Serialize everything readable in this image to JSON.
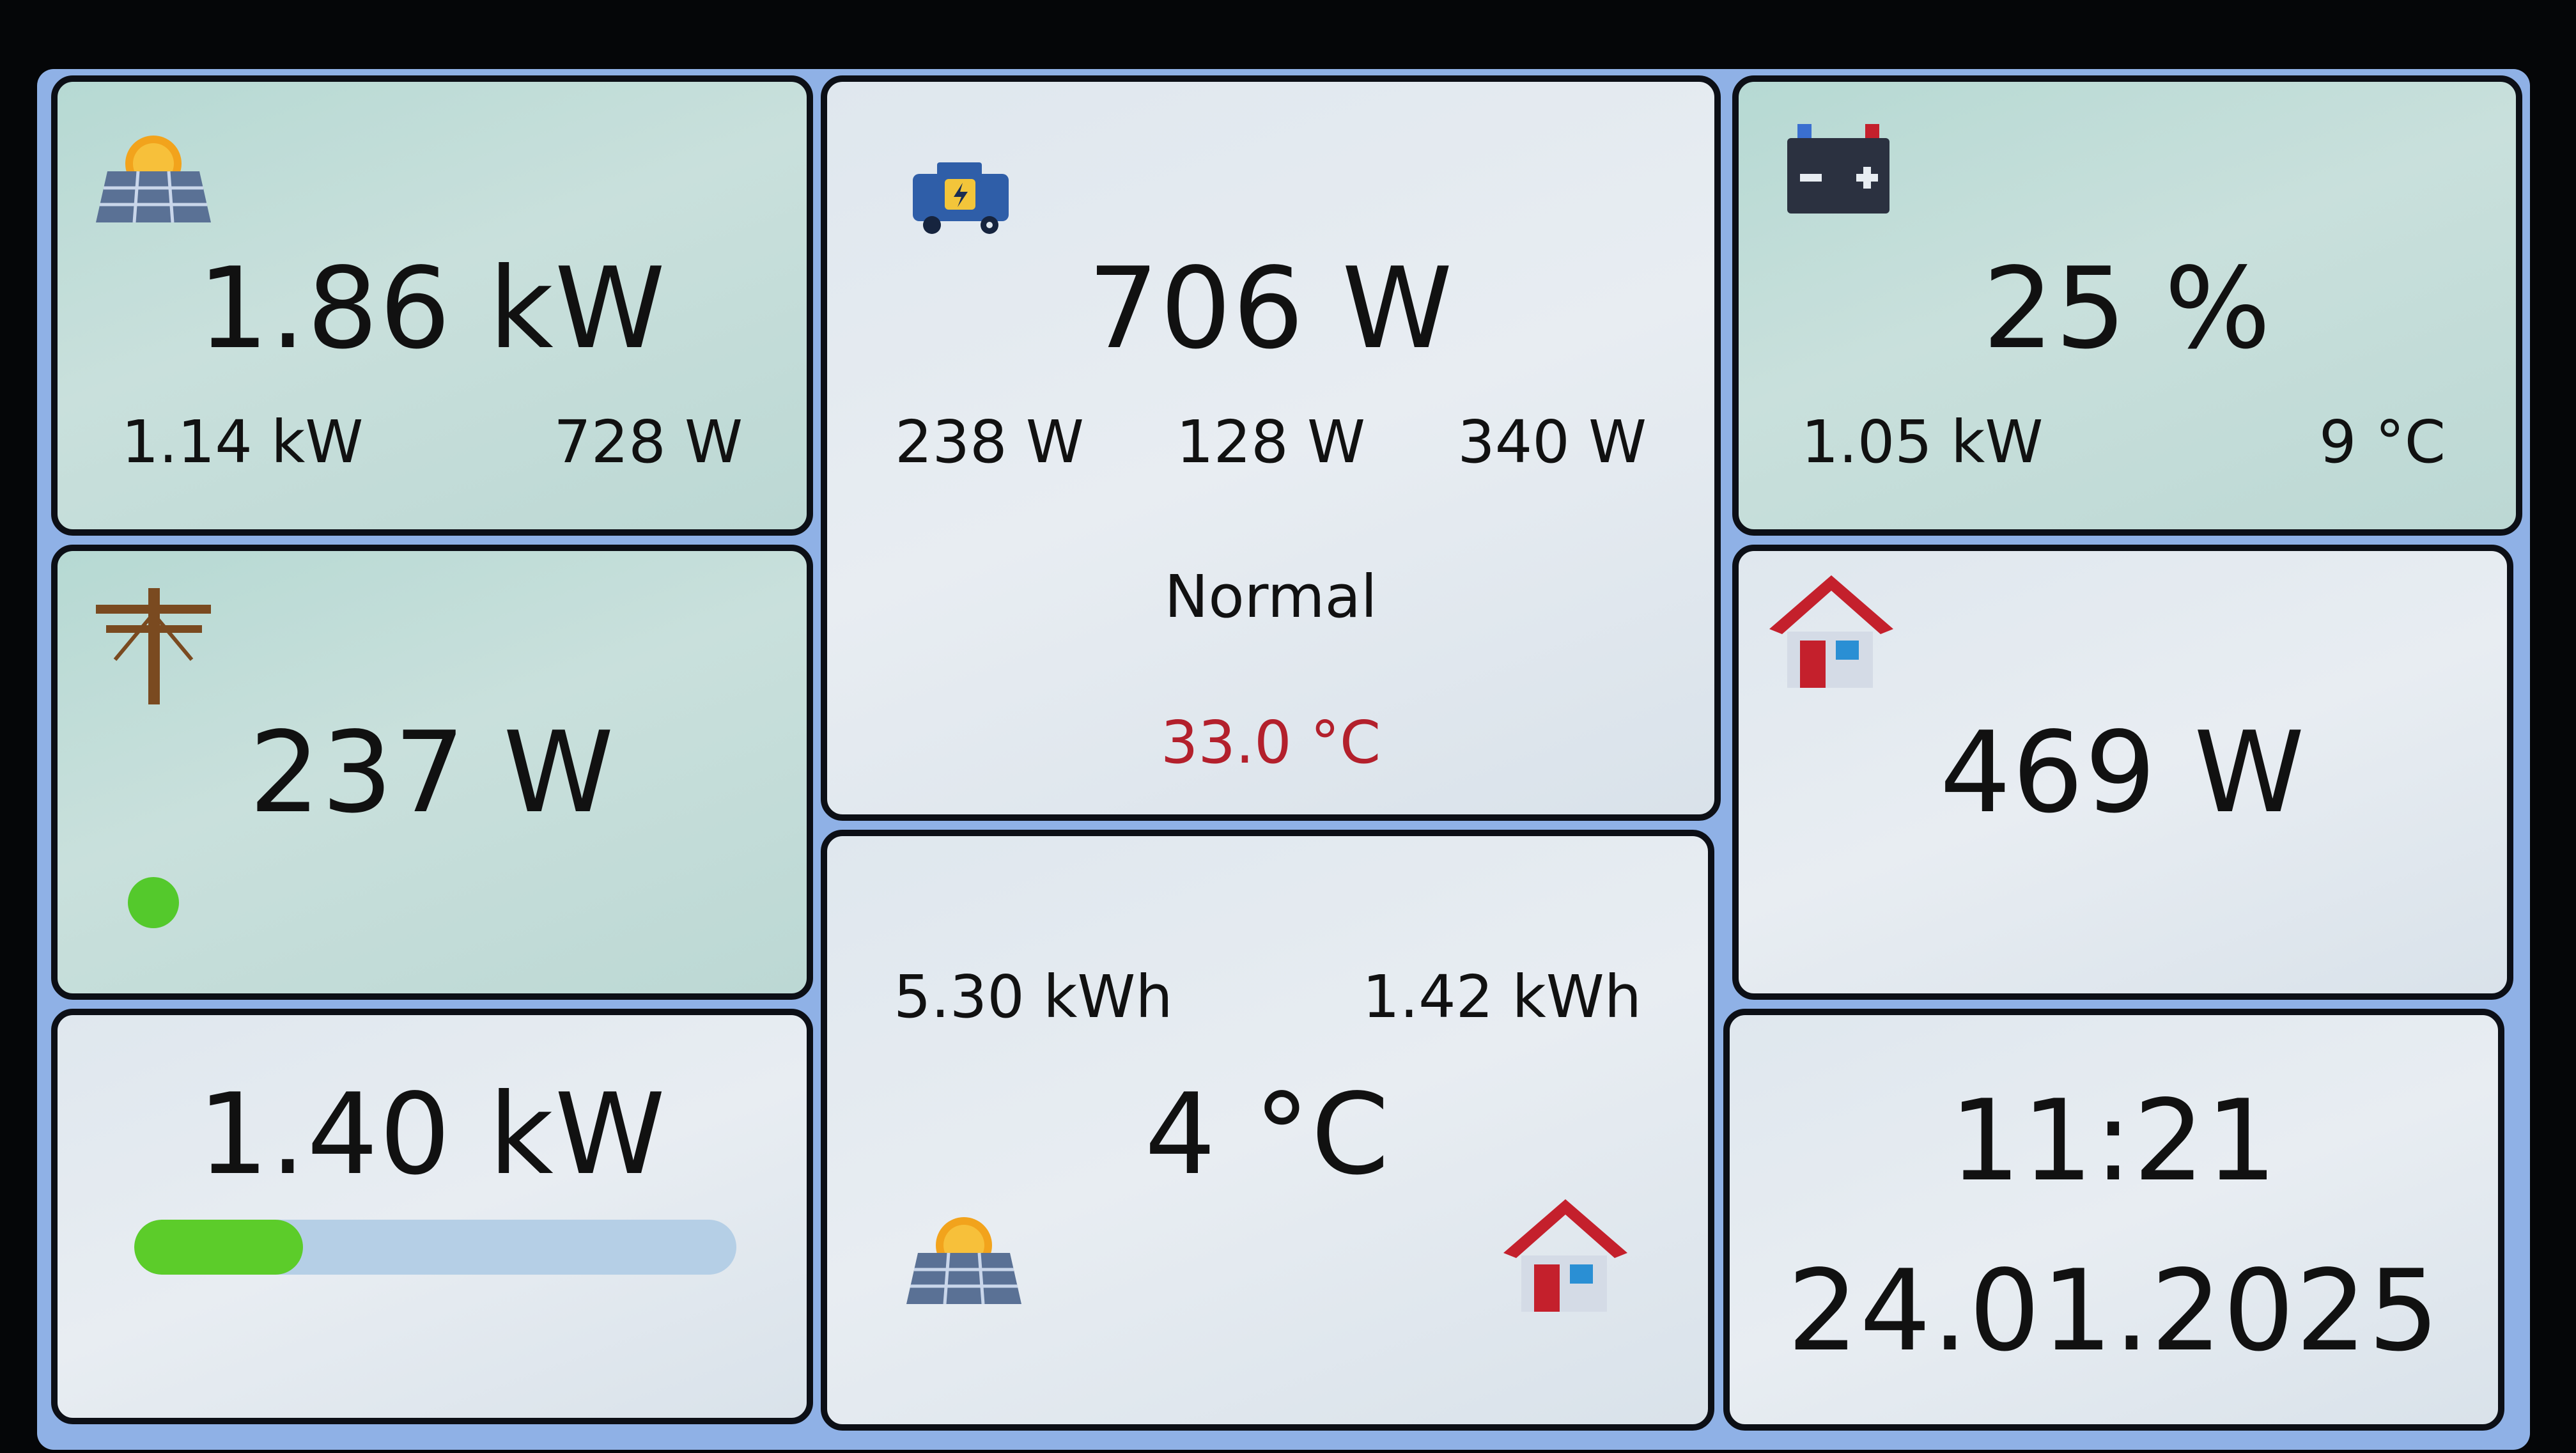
{
  "solar": {
    "icon": "solar-panel-icon",
    "total": "1.86 kW",
    "string1": "1.14 kW",
    "string2": "728 W"
  },
  "inverter": {
    "icon": "inverter-icon",
    "total": "706 W",
    "phase1": "238 W",
    "phase2": "128 W",
    "phase3": "340 W",
    "status": "Normal",
    "temperature": "33.0 °C",
    "temperature_color": "#b3202c"
  },
  "battery": {
    "icon": "battery-icon",
    "soc": "25 %",
    "power": "1.05 kW",
    "temperature": "9 °C"
  },
  "grid": {
    "icon": "power-pole-icon",
    "power": "237 W",
    "status_color": "#54c92c"
  },
  "home": {
    "icon": "house-icon",
    "load": "469 W"
  },
  "load_bar": {
    "power": "1.40 kW",
    "fill_fraction": 0.28,
    "fill_color": "#5ccc2a"
  },
  "daily": {
    "solar_energy": "5.30 kWh",
    "home_energy": "1.42 kWh",
    "outdoor_temp": "4 °C",
    "solar_icon": "solar-panel-icon",
    "home_icon": "house-icon"
  },
  "clock": {
    "time": "11:21",
    "date": "24.01.2025"
  }
}
